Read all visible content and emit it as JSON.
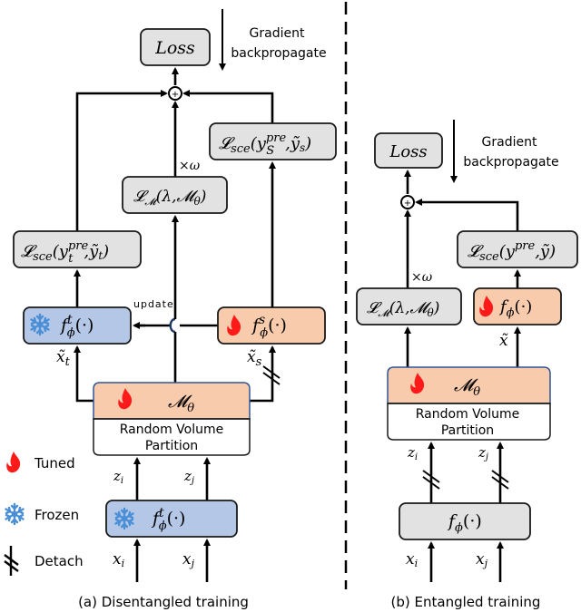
{
  "colors": {
    "gray_box": "#e2e2e2",
    "frozen_box": "#b4c7e7",
    "tuned_box": "#f8cbad",
    "flame": "#ff1a1a",
    "snowflake": "#4a8fd6"
  },
  "legend": {
    "tuned": "Tuned",
    "frozen": "Frozen",
    "detach": "Detach"
  },
  "panel_a": {
    "caption": "(a) Disentangled training",
    "loss": "Loss",
    "gradient_line1": "Gradient",
    "gradient_line2": "backpropagate",
    "sum_symbol": "+",
    "loss_sce_s": "𝓛sce(y_s^pre, ỹ_s)",
    "loss_sce_s_main": "𝓛",
    "loss_sce_s_sub": "sce",
    "loss_sce_s_arg": "(y",
    "loss_sce_s_sup": "pre",
    "loss_sce_s_subs": "S",
    "loss_sce_s_tail": ",ỹ",
    "loss_sce_s_tailsub": "s",
    "loss_sce_s_close": ")",
    "loss_m": "𝓛",
    "loss_m_sub": "𝓜",
    "loss_m_arg": "(λ,𝓜",
    "loss_m_theta": "θ",
    "loss_m_close": ")",
    "omega": "×ω",
    "loss_sce_t_main": "𝓛",
    "loss_sce_t_sub": "sce",
    "loss_sce_t_arg": "(y",
    "loss_sce_t_sup": "pre",
    "loss_sce_t_subs": "t",
    "loss_sce_t_tail": ",ỹ",
    "loss_sce_t_tailsub": "t",
    "loss_sce_t_close": ")",
    "teacher_f": "f",
    "teacher_sup": "t",
    "teacher_sub": "ϕ",
    "teacher_arg": "(·)",
    "student_f": "f",
    "student_sup": "s",
    "student_sub": "ϕ",
    "student_arg": "(·)",
    "update": "update",
    "x_t": "x̃",
    "x_t_sub": "t",
    "x_s": "x̃",
    "x_s_sub": "s",
    "m_theta": "𝓜",
    "m_theta_sub": "θ",
    "partition_line1": "Random Volume",
    "partition_line2": "Partition",
    "z_i": "z",
    "z_i_sub": "i",
    "z_j": "z",
    "z_j_sub": "j",
    "encoder_f": "f",
    "encoder_sup": "t",
    "encoder_sub": "ϕ",
    "encoder_arg": "(·)",
    "x_i": "x",
    "x_i_sub": "i",
    "x_j": "x",
    "x_j_sub": "j"
  },
  "panel_b": {
    "caption": "(b) Entangled training",
    "loss": "Loss",
    "gradient_line1": "Gradient",
    "gradient_line2": "backpropagate",
    "sum_symbol": "+",
    "loss_sce_main": "𝓛",
    "loss_sce_sub": "sce",
    "loss_sce_arg": "(y",
    "loss_sce_sup": "pre",
    "loss_sce_tail": ",ỹ)",
    "loss_m": "𝓛",
    "loss_m_sub": "𝓜",
    "loss_m_arg": "(λ,𝓜",
    "loss_m_theta": "θ",
    "loss_m_close": ")",
    "omega": "×ω",
    "f": "f",
    "f_sub": "ϕ",
    "f_arg": "(·)",
    "x_tilde": "x̃",
    "m_theta": "𝓜",
    "m_theta_sub": "θ",
    "partition_line1": "Random Volume",
    "partition_line2": "Partition",
    "z_i": "z",
    "z_i_sub": "i",
    "z_j": "z",
    "z_j_sub": "j",
    "encoder_f": "f",
    "encoder_sub": "ϕ",
    "encoder_arg": "(·)",
    "x_i": "x",
    "x_i_sub": "i",
    "x_j": "x",
    "x_j_sub": "j"
  }
}
